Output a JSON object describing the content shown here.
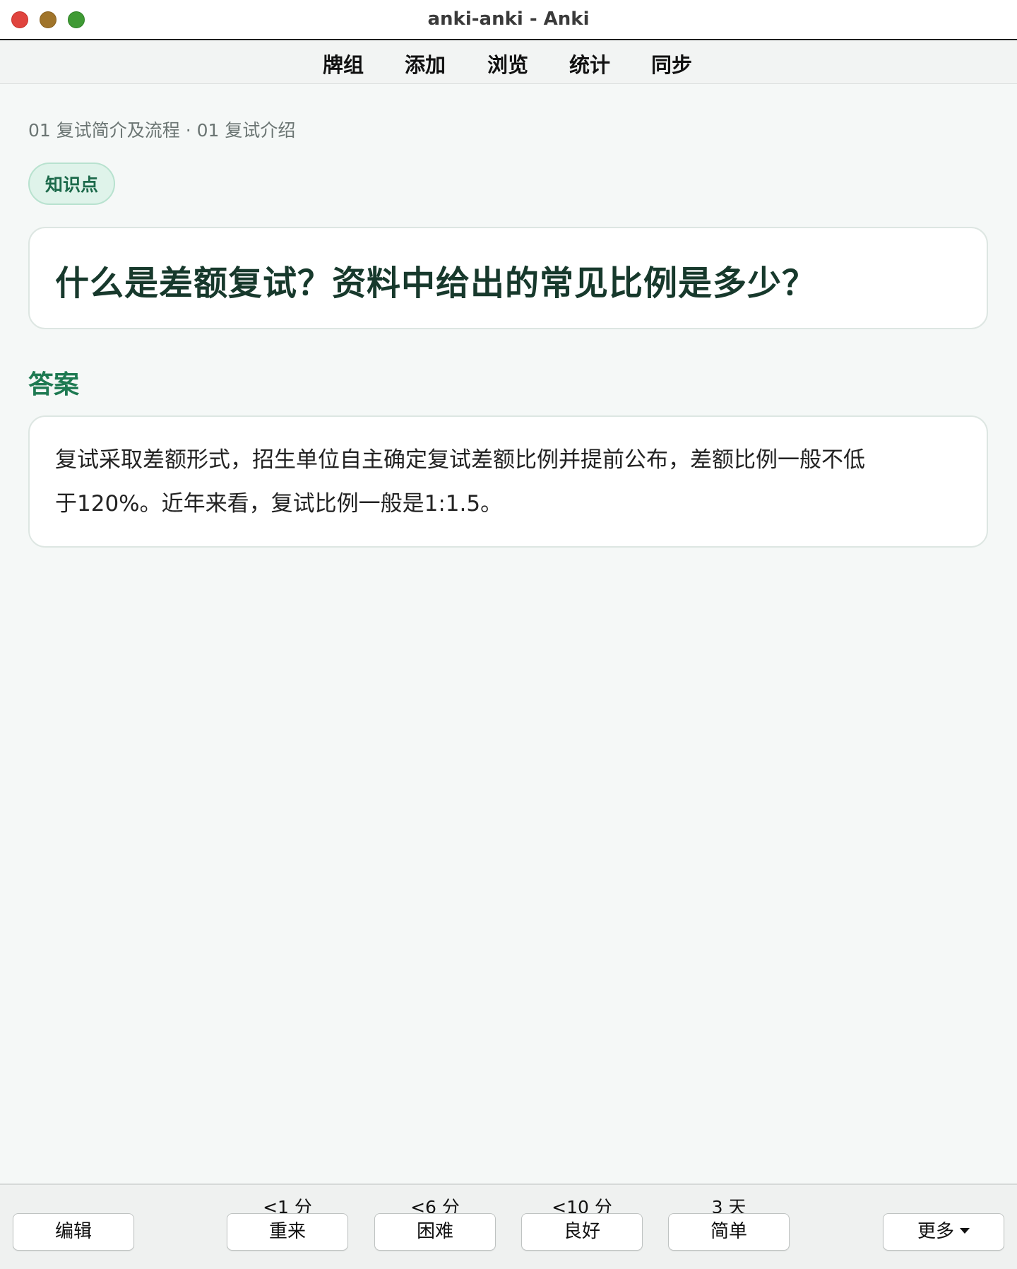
{
  "window": {
    "title": "anki-anki - Anki"
  },
  "toolbar": {
    "items": [
      "牌组",
      "添加",
      "浏览",
      "统计",
      "同步"
    ]
  },
  "card": {
    "breadcrumb": "01 复试简介及流程 · 01 复试介绍",
    "tag": "知识点",
    "question": "什么是差额复试？资料中给出的常见比例是多少？",
    "answer_heading": "答案",
    "answer_line1": "复试采取差额形式，招生单位自主确定复试差额比例并提前公布，差额比例一般不低",
    "answer_line2": "于120%。近年来看，复试比例一般是1:1.5。"
  },
  "bottom": {
    "edit_label": "编辑",
    "more_label": "更多",
    "answers": [
      {
        "interval": "<1 分",
        "label": "重来"
      },
      {
        "interval": "<6 分",
        "label": "困难"
      },
      {
        "interval": "<10 分",
        "label": "良好"
      },
      {
        "interval": "3 天",
        "label": "简单"
      }
    ]
  },
  "colors": {
    "accent_green": "#1e7a52",
    "tag_bg": "#dff3ea",
    "question_text": "#17392c",
    "content_bg": "#f5f8f7"
  },
  "icons": {
    "close": "close-window-icon",
    "minimize": "minimize-window-icon",
    "maximize": "maximize-window-icon",
    "more_caret": "caret-down-icon"
  }
}
